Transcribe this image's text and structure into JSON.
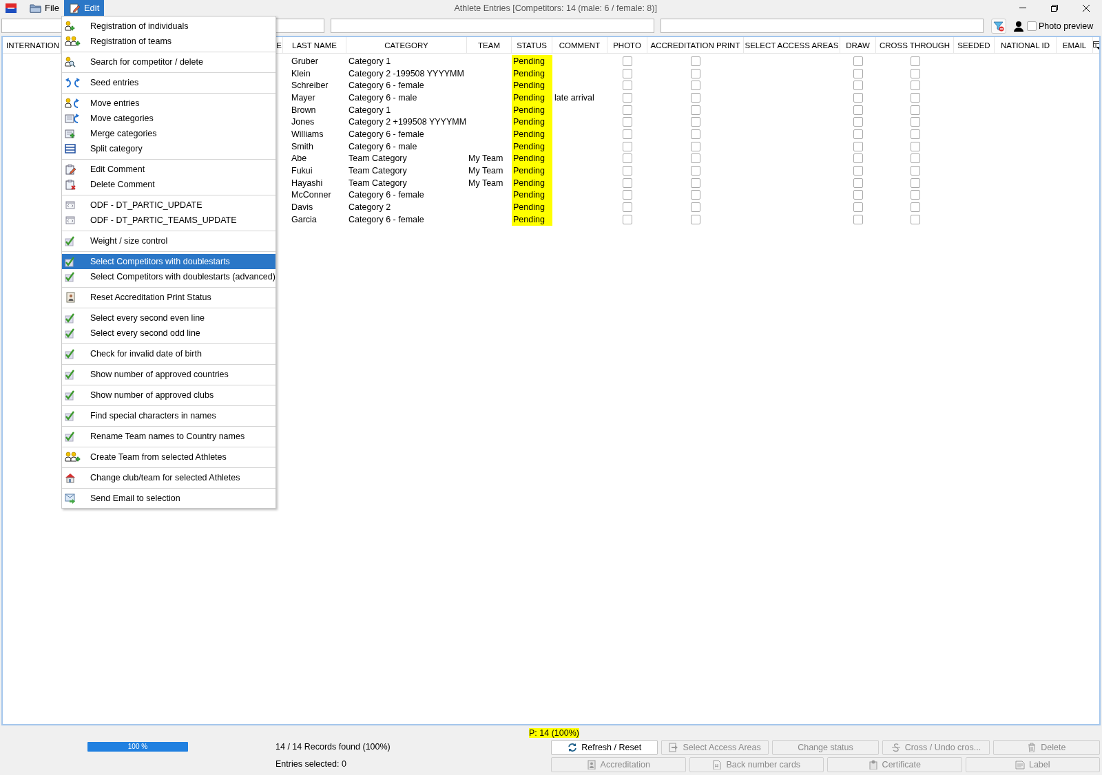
{
  "window": {
    "title": "Athlete Entries [Competitors: 14 (male: 6 / female: 8)]"
  },
  "menu_bar": [
    {
      "label": "File",
      "kind": "file",
      "selected": false
    },
    {
      "label": "Edit",
      "kind": "edit",
      "selected": true
    }
  ],
  "photo_preview": {
    "label": "Photo preview",
    "checked": false
  },
  "table": {
    "columns": [
      "INTERNATION",
      "E",
      "LAST NAME",
      "CATEGORY",
      "TEAM",
      "STATUS",
      "COMMENT",
      "PHOTO",
      "ACCREDITATION PRINT",
      "SELECT ACCESS AREAS",
      "DRAW",
      "CROSS THROUGH",
      "SEEDED",
      "NATIONAL ID",
      "EMAIL"
    ],
    "rows": [
      {
        "last_name": "Gruber",
        "category": "Category 1",
        "status": "Pending",
        "photo": false,
        "accreditation_print": false,
        "draw": false,
        "cross_through": false
      },
      {
        "last_name": "Klein",
        "category": "Category 2 -199508 YYYYMM",
        "status": "Pending",
        "photo": false,
        "accreditation_print": false,
        "draw": false,
        "cross_through": false
      },
      {
        "last_name": "Schreiber",
        "category": "Category 6 - female",
        "status": "Pending",
        "photo": false,
        "accreditation_print": false,
        "draw": false,
        "cross_through": false
      },
      {
        "last_name": "Mayer",
        "category": "Category 6 - male",
        "status": "Pending",
        "comment": "late arrival",
        "photo": false,
        "accreditation_print": false,
        "draw": false,
        "cross_through": false
      },
      {
        "last_name": "Brown",
        "category": "Category 1",
        "status": "Pending",
        "photo": false,
        "accreditation_print": false,
        "draw": false,
        "cross_through": false
      },
      {
        "last_name": "Jones",
        "category": "Category 2 +199508 YYYYMM",
        "status": "Pending",
        "photo": false,
        "accreditation_print": false,
        "draw": false,
        "cross_through": false
      },
      {
        "last_name": "Williams",
        "category": "Category 6 - female",
        "status": "Pending",
        "photo": false,
        "accreditation_print": false,
        "draw": false,
        "cross_through": false
      },
      {
        "last_name": "Smith",
        "category": "Category 6 - male",
        "status": "Pending",
        "photo": false,
        "accreditation_print": false,
        "draw": false,
        "cross_through": false
      },
      {
        "last_name": "Abe",
        "category": "Team Category",
        "team": "My Team",
        "status": "Pending",
        "photo": false,
        "accreditation_print": false,
        "draw": false,
        "cross_through": false
      },
      {
        "last_name": "Fukui",
        "category": "Team Category",
        "team": "My Team",
        "status": "Pending",
        "photo": false,
        "accreditation_print": false,
        "draw": false,
        "cross_through": false
      },
      {
        "last_name": "Hayashi",
        "category": "Team Category",
        "team": "My Team",
        "status": "Pending",
        "photo": false,
        "accreditation_print": false,
        "draw": false,
        "cross_through": false
      },
      {
        "last_name": "McConner",
        "category": "Category 6 - female",
        "status": "Pending",
        "photo": false,
        "accreditation_print": false,
        "draw": false,
        "cross_through": false
      },
      {
        "last_name": "Davis",
        "category": "Category 2",
        "status": "Pending",
        "photo": false,
        "accreditation_print": false,
        "draw": false,
        "cross_through": false
      },
      {
        "last_name": "Garcia",
        "category": "Category 6 - female",
        "status": "Pending",
        "photo": false,
        "accreditation_print": false,
        "draw": false,
        "cross_through": false
      }
    ]
  },
  "edit_menu": {
    "groups": [
      {
        "items": [
          {
            "label": "Registration of individuals",
            "kind": "athlete",
            "selected": false
          },
          {
            "label": "Registration of teams",
            "kind": "team",
            "selected": false
          }
        ]
      },
      {
        "items": [
          {
            "label": "Search for competitor / delete",
            "kind": "search",
            "selected": false
          }
        ]
      },
      {
        "items": [
          {
            "label": "Seed entries",
            "kind": "seed",
            "selected": false
          }
        ]
      },
      {
        "items": [
          {
            "label": "Move entries",
            "kind": "move",
            "selected": false
          },
          {
            "label": "Move categories",
            "kind": "movecat",
            "selected": false
          },
          {
            "label": "Merge categories",
            "kind": "merge",
            "selected": false
          },
          {
            "label": "Split category",
            "kind": "split",
            "selected": false
          }
        ]
      },
      {
        "items": [
          {
            "label": "Edit Comment",
            "kind": "edit",
            "selected": false
          },
          {
            "label": "Delete Comment",
            "kind": "delete",
            "selected": false
          }
        ]
      },
      {
        "items": [
          {
            "label": "ODF - DT_PARTIC_UPDATE",
            "kind": "odf",
            "selected": false
          },
          {
            "label": "ODF - DT_PARTIC_TEAMS_UPDATE",
            "kind": "odf",
            "selected": false
          }
        ]
      },
      {
        "items": [
          {
            "label": "Weight / size control",
            "kind": "check",
            "selected": false
          }
        ]
      },
      {
        "items": [
          {
            "label": "Select Competitors with doublestarts",
            "kind": "check",
            "selected": true
          },
          {
            "label": "Select Competitors with doublestarts (advanced)",
            "kind": "check",
            "selected": false
          }
        ]
      },
      {
        "items": [
          {
            "label": "Reset Accreditation Print Status",
            "kind": "card",
            "selected": false
          }
        ]
      },
      {
        "items": [
          {
            "label": "Select every second even line",
            "kind": "check",
            "selected": false
          },
          {
            "label": "Select every second odd line",
            "kind": "check",
            "selected": false
          }
        ]
      },
      {
        "items": [
          {
            "label": "Check for invalid date of birth",
            "kind": "check",
            "selected": false
          }
        ]
      },
      {
        "items": [
          {
            "label": "Show number of approved countries",
            "kind": "check",
            "selected": false
          }
        ]
      },
      {
        "items": [
          {
            "label": "Show number of approved clubs",
            "kind": "check",
            "selected": false
          }
        ]
      },
      {
        "items": [
          {
            "label": "Find special characters in names",
            "kind": "check",
            "selected": false
          }
        ]
      },
      {
        "items": [
          {
            "label": "Rename Team names to Country names",
            "kind": "check",
            "selected": false
          }
        ]
      },
      {
        "items": [
          {
            "label": "Create Team from selected Athletes",
            "kind": "team",
            "selected": false
          }
        ]
      },
      {
        "items": [
          {
            "label": "Change club/team for selected Athletes",
            "kind": "club",
            "selected": false
          }
        ]
      },
      {
        "items": [
          {
            "label": "Send Email to selection",
            "kind": "mail",
            "selected": false
          }
        ]
      }
    ]
  },
  "footer": {
    "summary": "P: 14 (100%)",
    "progress": {
      "level": 1,
      "label": "100 %"
    },
    "records": "14 / 14 Records found (100%)",
    "selected_count": "Entries selected: 0",
    "buttons": [
      {
        "label": "Refresh / Reset",
        "kind": "refresh",
        "disabled": false
      },
      {
        "label": "Select Access Areas",
        "kind": "access",
        "disabled": true
      },
      {
        "label": "Change status",
        "kind": "status",
        "disabled": true
      },
      {
        "label": "Cross / Undo cros...",
        "kind": "cross",
        "disabled": true
      },
      {
        "label": "Delete",
        "kind": "delete",
        "disabled": true
      },
      {
        "label": "Accreditation",
        "kind": "accreditation",
        "disabled": true
      },
      {
        "label": "Back number cards",
        "kind": "numbers",
        "disabled": true
      },
      {
        "label": "Certificate",
        "kind": "certificate",
        "disabled": true
      },
      {
        "label": "Label",
        "kind": "label",
        "disabled": true
      }
    ]
  }
}
